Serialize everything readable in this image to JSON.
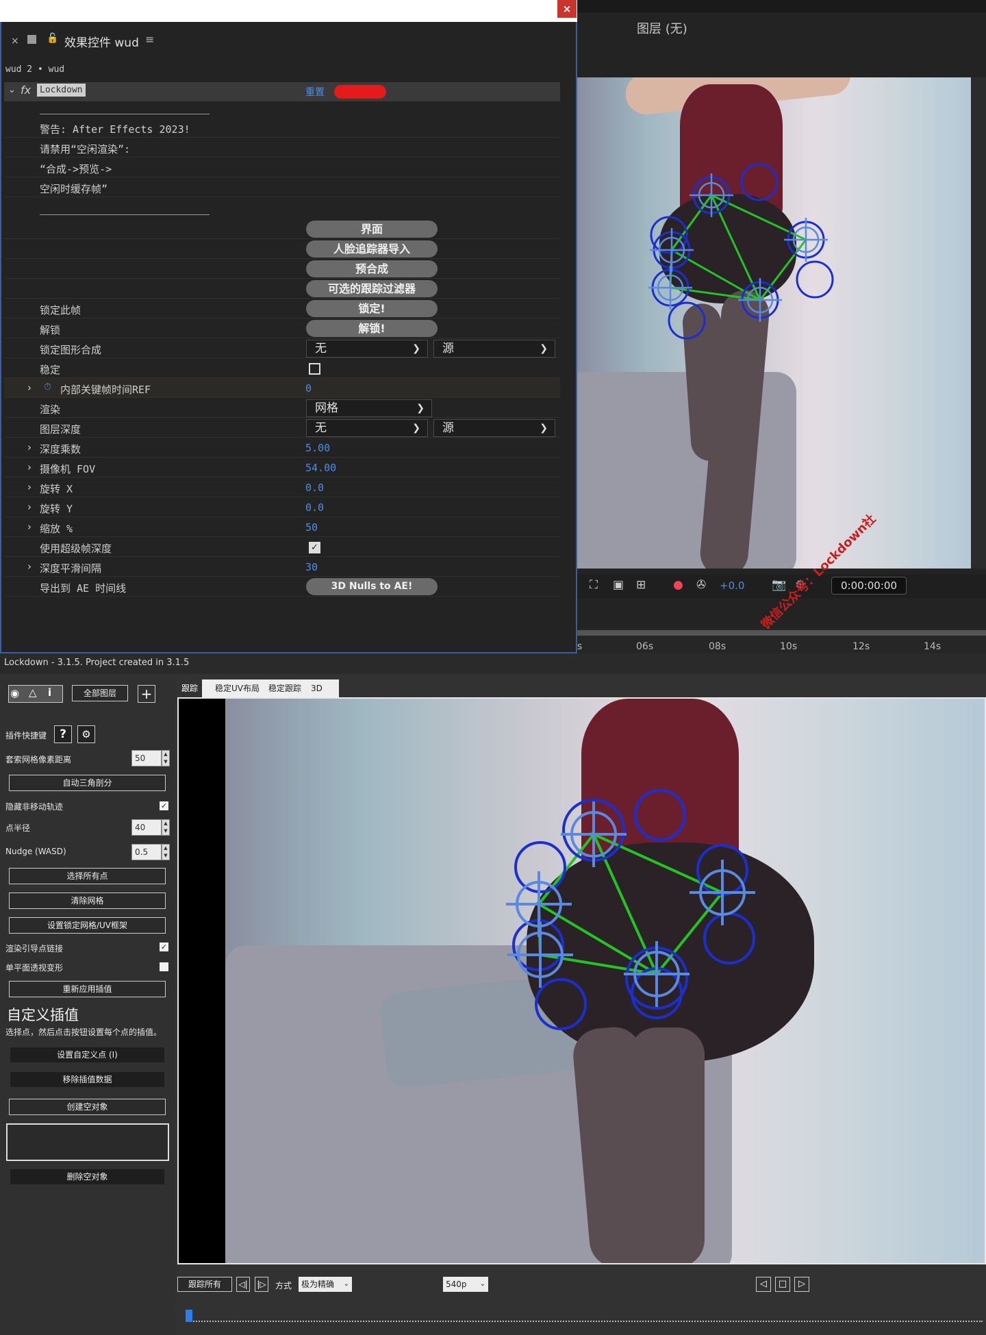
{
  "effects_panel": {
    "title": "效果控件 wud",
    "breadcrumb": "wud 2 • wud",
    "effect_name": "Lockdown",
    "reset_label": "重置",
    "warn_lines": [
      "警告: After Effects 2023!",
      "请禁用“空闲渲染”:",
      "“合成->预览->",
      "空闲时缓存帧”"
    ],
    "buttons": {
      "interface": "界面",
      "face_import": "人脸追踪器导入",
      "precompose": "预合成",
      "optional_filter": "可选的跟踪过滤器",
      "lock": "锁定!",
      "unlock": "解锁!",
      "nulls": "3D Nulls to AE!"
    },
    "params": {
      "lock_frame": "锁定此帧",
      "unlock": "解锁",
      "lock_shape_comp": "锁定图形合成",
      "lock_shape_sel1": "无",
      "lock_shape_sel2": "源",
      "stabilize": "稳定",
      "internal_keyframe": "内部关键帧时间REF",
      "internal_keyframe_value": "0",
      "render": "渲染",
      "render_sel": "网格",
      "layer_depth": "图层深度",
      "layer_depth_sel1": "无",
      "layer_depth_sel2": "源",
      "depth_mult": "深度乘数",
      "depth_mult_value": "5.00",
      "camera_fov": "摄像机 FOV",
      "camera_fov_value": "54.00",
      "rot_x": "旋转 X",
      "rot_x_value": "0.0",
      "rot_y": "旋转 Y",
      "rot_y_value": "0.0",
      "scale": "缩放 %",
      "scale_value": "50",
      "super_frame_depth": "使用超级帧深度",
      "depth_smooth": "深度平滑间隔",
      "depth_smooth_value": "30",
      "export_ae": "导出到 AE 时间线"
    }
  },
  "viewer": {
    "title": "图层 (无)",
    "exposure": "+0.0",
    "timecode": "0:00:00:00",
    "ruler": [
      "s",
      "06s",
      "08s",
      "10s",
      "12s",
      "14s"
    ],
    "watermark": "微信公众号：Lockdown社"
  },
  "plugin": {
    "title": "Lockdown - 3.1.5. Project created in 3.1.5",
    "all_layers": "全部图层",
    "shortcuts_label": "插件快捷键",
    "lasso_label": "套索网格像素距离",
    "lasso_value": "50",
    "auto_triangulate": "自动三角剖分",
    "hide_static": "隐藏非移动轨迹",
    "point_radius_label": "点半径",
    "point_radius_value": "40",
    "nudge_label": "Nudge (WASD)",
    "nudge_value": "0.5",
    "select_all": "选择所有点",
    "clear_mesh": "清除网格",
    "set_lock_mesh": "设置锁定网格/UV框架",
    "render_guides": "渲染引导点链接",
    "single_persp": "单平面透视变形",
    "reapply": "重新应用插值",
    "custom_title": "自定义插值",
    "custom_desc": "选择点，然后点击按钮设置每个点的插值。",
    "set_custom": "设置自定义点 (I)",
    "remove_interp": "移除插值数据",
    "create_null": "创建空对象",
    "delete_null": "删除空对象",
    "tabs": [
      "跟踪",
      "稳定UV布局",
      "稳定跟踪",
      "3D"
    ],
    "track_all": "跟踪所有",
    "method_label": "方式",
    "method_value": "极为精确",
    "resolution": "540p"
  },
  "colors": {
    "accent_blue": "#4b8ee8",
    "tracker_blue": "#1b2fd0",
    "tracker_light": "#5a8ae0",
    "mesh_green": "#22c422"
  }
}
